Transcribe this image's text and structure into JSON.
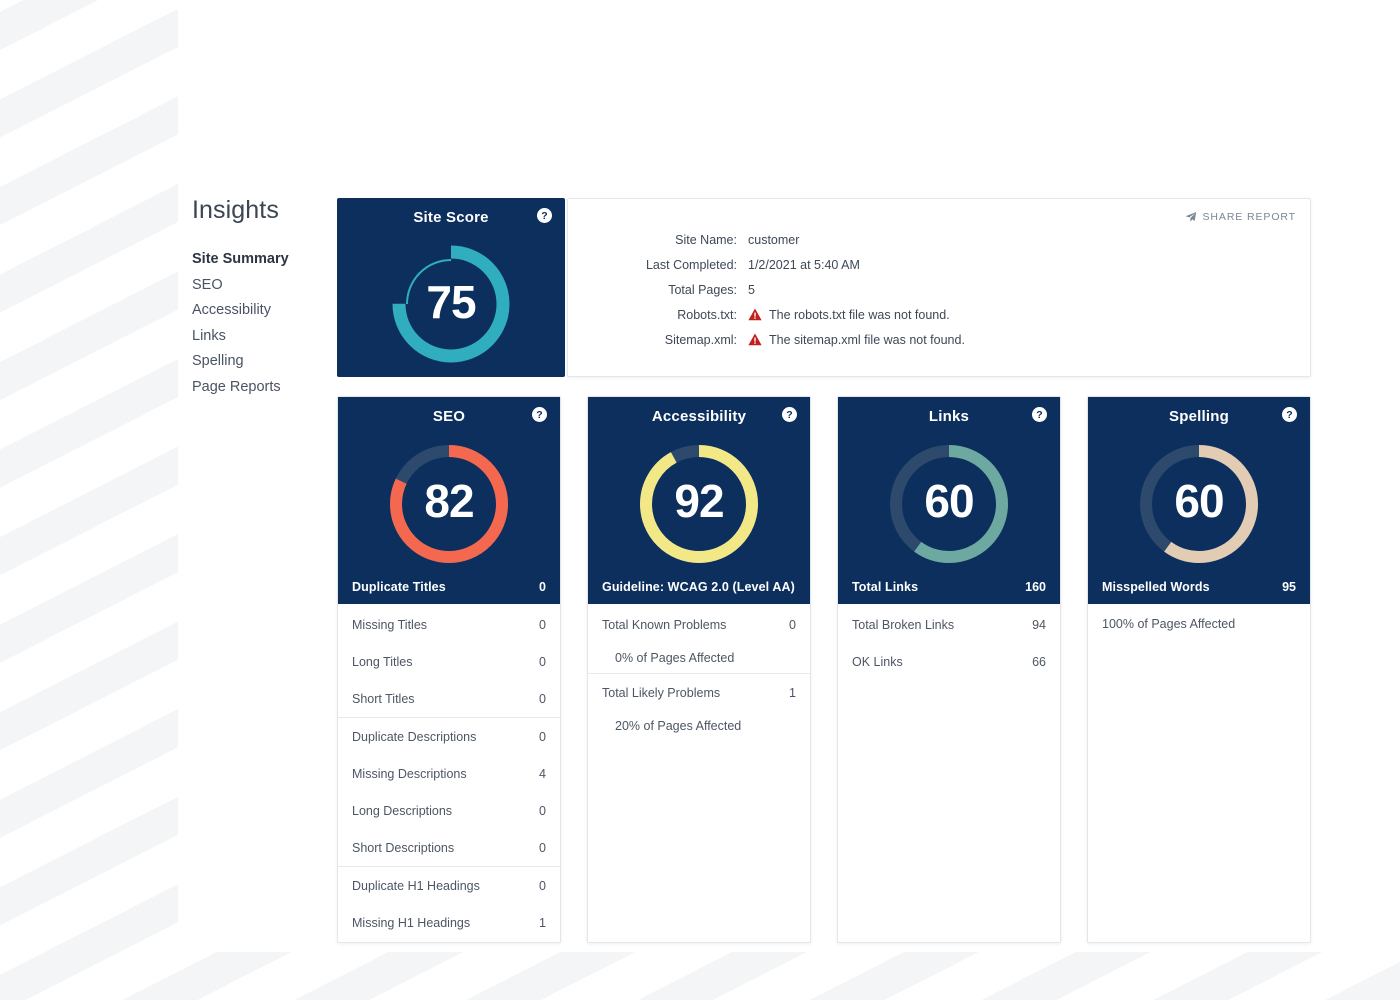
{
  "sidebar": {
    "heading": "Insights",
    "items": [
      {
        "label": "Site Summary",
        "active": true
      },
      {
        "label": "SEO",
        "active": false
      },
      {
        "label": "Accessibility",
        "active": false
      },
      {
        "label": "Links",
        "active": false
      },
      {
        "label": "Spelling",
        "active": false
      },
      {
        "label": "Page Reports",
        "active": false
      }
    ]
  },
  "colors": {
    "navy": "#0c2f5e",
    "slate": "#2d4a6d",
    "teal": "#31adc0",
    "coral": "#f4684f",
    "yellow": "#f2e887",
    "green": "#6da9a0",
    "tan": "#e2cdb4",
    "warning_red": "#c0211f"
  },
  "site_score": {
    "title": "Site Score",
    "value": "75",
    "help_icon": "help-circle-icon"
  },
  "info": {
    "share_label": "SHARE REPORT",
    "share_icon": "send-plane-icon",
    "rows": [
      {
        "key": "Site Name:",
        "value": "customer",
        "warning": false
      },
      {
        "key": "Last Completed:",
        "value": "1/2/2021 at 5:40 AM",
        "warning": false
      },
      {
        "key": "Total Pages:",
        "value": "5",
        "warning": false
      },
      {
        "key": "Robots.txt:",
        "value": "The robots.txt file was not found.",
        "warning": true
      },
      {
        "key": "Sitemap.xml:",
        "value": "The sitemap.xml file was not found.",
        "warning": true
      }
    ]
  },
  "cards": {
    "seo": {
      "title": "SEO",
      "help_icon": "help-circle-icon",
      "footer_label": "Duplicate Titles",
      "footer_value": "0",
      "groups": [
        [
          {
            "label": "Missing Titles",
            "value": "0"
          },
          {
            "label": "Long Titles",
            "value": "0"
          },
          {
            "label": "Short Titles",
            "value": "0"
          }
        ],
        [
          {
            "label": "Duplicate Descriptions",
            "value": "0"
          },
          {
            "label": "Missing Descriptions",
            "value": "4"
          },
          {
            "label": "Long Descriptions",
            "value": "0"
          },
          {
            "label": "Short Descriptions",
            "value": "0"
          }
        ],
        [
          {
            "label": "Duplicate H1 Headings",
            "value": "0"
          },
          {
            "label": "Missing H1 Headings",
            "value": "1"
          }
        ]
      ]
    },
    "accessibility": {
      "title": "Accessibility",
      "help_icon": "help-circle-icon",
      "footer_label": "Guideline: WCAG 2.0 (Level AA)",
      "footer_value": "",
      "groups": [
        [
          {
            "label": "Total Known Problems",
            "value": "0"
          },
          {
            "label": "0% of Pages Affected",
            "value": "",
            "sub": true
          }
        ],
        [
          {
            "label": "Total Likely Problems",
            "value": "1"
          },
          {
            "label": "20% of Pages Affected",
            "value": "",
            "sub": true
          }
        ]
      ]
    },
    "links": {
      "title": "Links",
      "help_icon": "help-circle-icon",
      "footer_label": "Total Links",
      "footer_value": "160",
      "groups": [
        [
          {
            "label": "Total Broken Links",
            "value": "94"
          },
          {
            "label": "OK Links",
            "value": "66"
          }
        ]
      ]
    },
    "spelling": {
      "title": "Spelling",
      "help_icon": "help-circle-icon",
      "footer_label": "Misspelled Words",
      "footer_value": "95",
      "note": "100% of Pages Affected"
    }
  },
  "chart_data": [
    {
      "type": "pie",
      "name": "site-score-donut",
      "title": "Site Score",
      "value": 75,
      "max": 100,
      "center_label": "75",
      "segments": [
        {
          "name": "score",
          "value": 75,
          "color": "#31adc0"
        },
        {
          "name": "remainder",
          "value": 25,
          "color": "#0c2f5e"
        }
      ],
      "inner_track": {
        "name": "remainder-track",
        "value": 25,
        "color": "#31adc0"
      }
    },
    {
      "type": "pie",
      "name": "seo-donut",
      "title": "SEO",
      "value": 82,
      "max": 100,
      "center_label": "82",
      "segments": [
        {
          "name": "score",
          "value": 82,
          "color": "#f4684f"
        },
        {
          "name": "remainder",
          "value": 18,
          "color": "#2d4a6d"
        }
      ]
    },
    {
      "type": "pie",
      "name": "accessibility-donut",
      "title": "Accessibility",
      "value": 92,
      "max": 100,
      "center_label": "92",
      "segments": [
        {
          "name": "score",
          "value": 92,
          "color": "#f2e887"
        },
        {
          "name": "remainder",
          "value": 8,
          "color": "#2d4a6d"
        }
      ]
    },
    {
      "type": "pie",
      "name": "links-donut",
      "title": "Links",
      "value": 60,
      "max": 100,
      "center_label": "60",
      "segments": [
        {
          "name": "score",
          "value": 60,
          "color": "#6da9a0"
        },
        {
          "name": "remainder",
          "value": 40,
          "color": "#2d4a6d"
        }
      ]
    },
    {
      "type": "pie",
      "name": "spelling-donut",
      "title": "Spelling",
      "value": 60,
      "max": 100,
      "center_label": "60",
      "segments": [
        {
          "name": "score",
          "value": 60,
          "color": "#e2cdb4"
        },
        {
          "name": "remainder",
          "value": 40,
          "color": "#2d4a6d"
        }
      ]
    }
  ]
}
